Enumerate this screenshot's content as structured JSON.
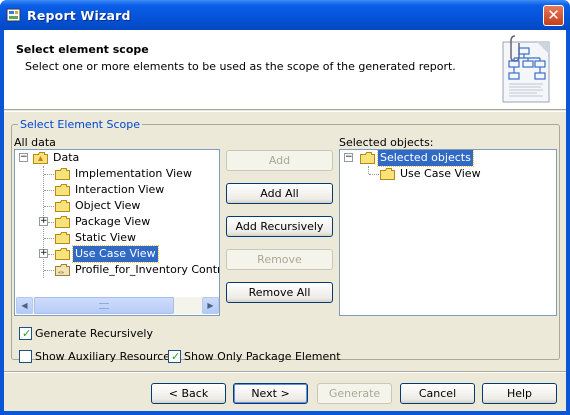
{
  "window": {
    "title": "Report Wizard",
    "close_label": "✕"
  },
  "header": {
    "title": "Select element scope",
    "subtitle": "Select one or more elements to be used as the scope of the generated report."
  },
  "group": {
    "legend": "Select Element Scope"
  },
  "left_panel": {
    "label": "All data",
    "root": "Data",
    "items": [
      "Implementation View",
      "Interaction View",
      "Object View",
      "Package View",
      "Static View",
      "Use Case View",
      "Profile_for_Inventory Control S"
    ],
    "selected_item": "Use Case View"
  },
  "right_panel": {
    "label": "Selected objects:",
    "root": "Selected objects",
    "items": [
      "Use Case View"
    ]
  },
  "actions": {
    "add": "Add",
    "add_all": "Add All",
    "add_recursively": "Add Recursively",
    "remove": "Remove",
    "remove_all": "Remove All"
  },
  "options": {
    "generate_recursively": {
      "label": "Generate Recursively",
      "checked": true
    },
    "show_auxiliary": {
      "label": "Show Auxiliary Resources",
      "checked": false
    },
    "show_only_package": {
      "label": "Show Only Package Element",
      "checked": true
    }
  },
  "footer": {
    "back": "< Back",
    "next": "Next >",
    "generate": "Generate",
    "cancel": "Cancel",
    "help": "Help"
  },
  "colors": {
    "titlebar": "#0553d8",
    "selection": "#316ac5",
    "legend": "#0046d5",
    "dialog_bg": "#ece9d8"
  }
}
